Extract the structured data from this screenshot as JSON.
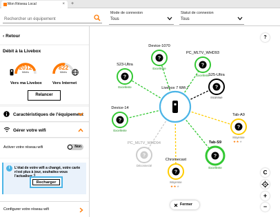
{
  "browser": {
    "tab_title": "Mon Réseau Local"
  },
  "filters": {
    "search_placeholder": "Rechercher un équipement",
    "mode": {
      "label": "Mode de connexion",
      "value": "Tous"
    },
    "status": {
      "label": "Statut de connexion",
      "value": "Tous"
    }
  },
  "sidebar": {
    "back_label": "Retour",
    "debit": {
      "title": "Débit à la Livebox",
      "livebox": {
        "value": "2012",
        "unit": "Mbit/s",
        "caption": "Vers ma Livebox",
        "level": 0.9
      },
      "internet": {
        "value": "822",
        "unit": "Mbit/s",
        "caption": "Vers Internet",
        "level": 0.55
      },
      "refresh_label": "Relancer"
    },
    "features_title": "Caractéristiques de l'équipement",
    "wifi": {
      "title": "Gérer votre wifi",
      "activate_label": "Activer votre réseau wifi",
      "toggle_text": "Non",
      "notice": "L'état de votre wifi a changé, votre carte n'est plus à jour, souhaitez-vous l'actualiser ?",
      "reload_label": "Recharger"
    },
    "configure_label": "Configurer votre réseau wifi"
  },
  "map": {
    "center": {
      "label": "Livebox 7 Wifi 7"
    },
    "devices": [
      {
        "name": "Device-1070",
        "status": "Excellente",
        "state": "excellent"
      },
      {
        "name": "PC_MLTV_WHD93",
        "status": "Excellente",
        "state": "excellent"
      },
      {
        "name": "S23-Ultra",
        "status": "Excellente",
        "state": "excellent"
      },
      {
        "name": "S25-Ultra",
        "status": "Inconnue",
        "state": "unknown"
      },
      {
        "name": "Device-14",
        "status": "Excellente",
        "state": "excellent"
      },
      {
        "name": "Tab-A9",
        "status": "Moyenne",
        "state": "medium"
      },
      {
        "name": "PC_MLTV_WHD94",
        "status": "Déconnecté",
        "state": "disconnected"
      },
      {
        "name": "Chromecast",
        "status": "Moyenne",
        "state": "medium"
      },
      {
        "name": "Tab-S9",
        "status": "Excellente",
        "state": "excellent"
      }
    ],
    "close_label": "Fermer",
    "colors": {
      "excellent": "#32c832",
      "medium": "#ffcc00",
      "unknown": "#000000",
      "disconnected": "#cccccc",
      "center": "#4bb4e6",
      "accent": "#ff7900"
    }
  }
}
